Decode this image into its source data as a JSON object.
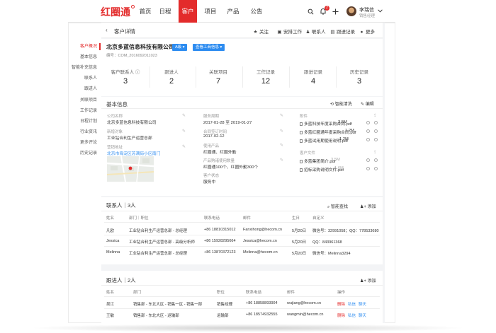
{
  "brand": {
    "logo": "红圈通",
    "accent": "#e32b2b",
    "link_color": "#2d8cf0"
  },
  "nav": {
    "items": [
      {
        "label": "首页"
      },
      {
        "label": "日程"
      },
      {
        "label": "客户"
      },
      {
        "label": "项目"
      },
      {
        "label": "产品"
      },
      {
        "label": "公告"
      }
    ],
    "notification_count": "2",
    "user_name": "李瑞信",
    "user_role": "销售经理"
  },
  "sidebar": {
    "items": [
      {
        "label": "客户概况"
      },
      {
        "label": "基本信息"
      },
      {
        "label": "智能补充信息"
      },
      {
        "label": "联系人"
      },
      {
        "label": "跟进人"
      },
      {
        "label": "关联项目"
      },
      {
        "label": "工作记录"
      },
      {
        "label": "日程计划"
      },
      {
        "label": "行业资讯"
      },
      {
        "label": "更多评论"
      },
      {
        "label": "历史记录"
      }
    ]
  },
  "header": {
    "title": "客户详情",
    "actions": {
      "follow": "关注",
      "schedule": "安排工作",
      "contact": "联系人",
      "record": "跟进记录",
      "more": "更多"
    }
  },
  "summary": {
    "company": "北京多蓝信息科技有限公司",
    "serial": "编号：COM_2016092011023",
    "level_tag": "A级",
    "business_btn": "查看工商信息"
  },
  "stats": [
    {
      "label": "客户联系人",
      "value": "3"
    },
    {
      "label": "跟进人",
      "value": "2"
    },
    {
      "label": "关联项目",
      "value": "7"
    },
    {
      "label": "工作记录",
      "value": "12"
    },
    {
      "label": "跟进记录",
      "value": "4"
    },
    {
      "label": "历史记录",
      "value": "3"
    }
  ],
  "basic": {
    "title": "基本信息",
    "smart_clean": "智能清洗",
    "edit": "编辑",
    "fields": {
      "company_label": "公司名称",
      "company_value": "北京多蓝信息科技有限公司",
      "contact_label": "新增对象",
      "contact_value": "工业钻合利生产运营总部",
      "address_label": "营销地址",
      "address_value": "北京市海淀区苏满街小区南门",
      "period_label": "服务周期",
      "period_value": "2017-01-28 至 2019-01-27",
      "date_label": "合同签订时间",
      "date_value": "2017-02-12",
      "product_label": "使用产品",
      "product_value": "红圈通、红圈外勤",
      "purchase_label": "产品购诸使用数量",
      "purchase_value": "红圈通100个、红圈外勤300个",
      "status_label": "客户状态",
      "status_value": "服务中",
      "attach_label": "附件",
      "attachments": [
        {
          "name": "多蓝科技年度采购合同.pdf",
          "size": "3.5M"
        },
        {
          "name": "多蓝红圈通年度采购合同.pdf",
          "size": "1.2M"
        },
        {
          "name": "多蓝试用期使用说明.pdf",
          "size": "1.2M"
        }
      ],
      "client_files_label": "客户文件",
      "client_files": [
        {
          "name": "多蓝集团简介.pdf",
          "size": "3.5M"
        },
        {
          "name": "招标采购说明文件.pdf",
          "size": "1.6M"
        }
      ]
    }
  },
  "contacts": {
    "title": "联系人｜3人",
    "smart_search": "智能查找",
    "add": "添加",
    "headers": [
      "姓名",
      "部门｜职位",
      "联系电话",
      "邮件",
      "生日",
      "自定义"
    ],
    "rows": [
      {
        "name": "凡欧",
        "dept": "工业钻合利生产运营总部 - 总经理",
        "phone": "+86 18810315012",
        "email": "Fanxihong@hecom.cn",
        "birthday": "5月20日",
        "custom": "微信号：32991058；QQ：778533680"
      },
      {
        "name": "Jessica",
        "dept": "工业钻合利生产运营总部 - 高级分析师",
        "phone": "+86 15928295664",
        "email": "Jessica@hecom.cn",
        "birthday": "5月20日",
        "custom": "QQ：843961368"
      },
      {
        "name": "Melinna",
        "dept": "工业钻合利生产运营总部 - 总经理",
        "phone": "+86 13870372123",
        "email": "Melinna@hecom.cn",
        "birthday": "5月20日",
        "custom": "微信号：Melinna3294"
      }
    ]
  },
  "followers": {
    "title": "跟进人｜2人",
    "add": "添加",
    "headers": [
      "姓名",
      "部门",
      "职位",
      "联系电话",
      "邮件",
      "操作"
    ],
    "rows": [
      {
        "name": "吴江",
        "dept": "销售部 - 东北大区 - 销售一区 - 销售一部",
        "role": "销售经理",
        "phone": "+86 18858893904",
        "email": "wujiang@hecom.cn",
        "op_del": "删除",
        "op_a": "私信",
        "op_b": "聊天"
      },
      {
        "name": "王敏",
        "dept": "销售部 - 东北大区 - 运输部",
        "role": "运输部",
        "phone": "+86 18574932555",
        "email": "wangmin@hecom.cn",
        "op_del": "删除",
        "op_a": "私信",
        "op_b": "聊天"
      }
    ]
  }
}
